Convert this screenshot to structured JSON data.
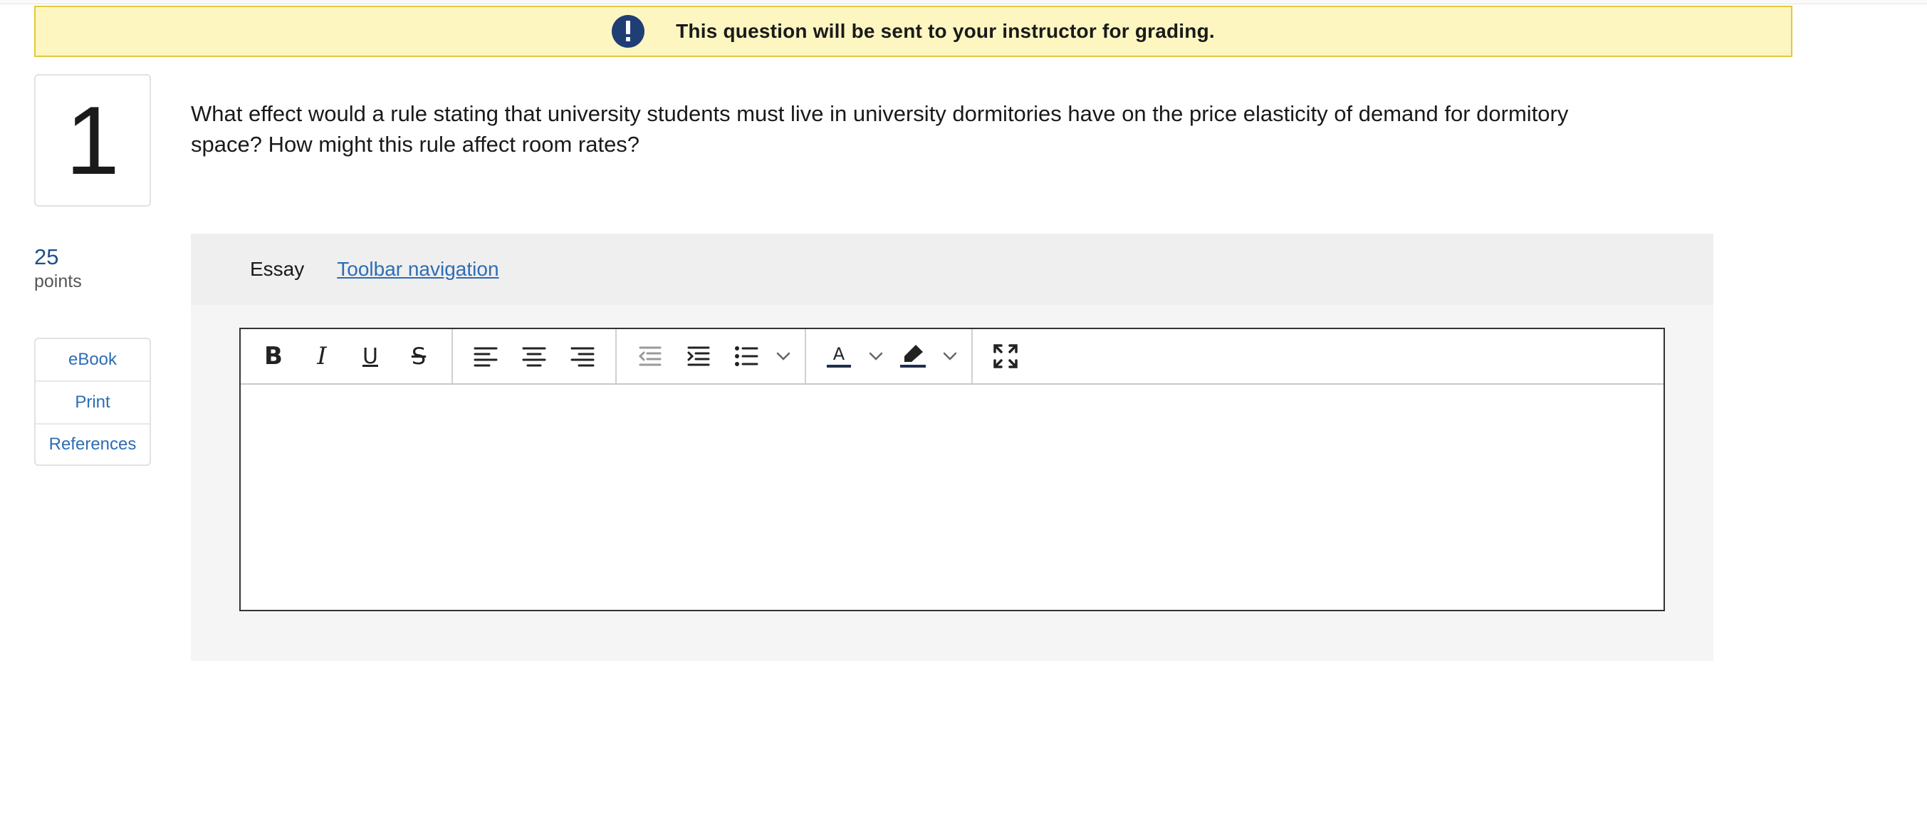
{
  "notice": {
    "icon": "exclamation-icon",
    "text": "This question will be sent to your instructor for grading."
  },
  "question": {
    "number": "1",
    "text": "What effect would a rule stating that university students must live in university dormitories have on the price elasticity of demand for dormitory space? How might this rule affect room rates?",
    "points_value": "25",
    "points_label": "points"
  },
  "side_links": [
    "eBook",
    "Print",
    "References"
  ],
  "essay": {
    "label": "Essay",
    "toolbar_nav_link": "Toolbar navigation ",
    "toolbar": {
      "bold": "B",
      "italic": "I",
      "underline": "U",
      "strikethrough": "S"
    },
    "content": ""
  },
  "colors": {
    "notice_bg": "#fdf6c1",
    "notice_border": "#e3c93c",
    "icon_bg": "#1f3e74",
    "link": "#2d6db5",
    "points": "#1f4e8c"
  }
}
